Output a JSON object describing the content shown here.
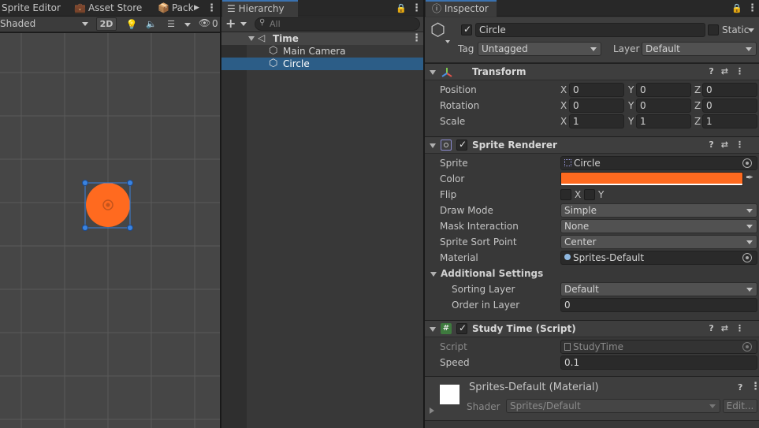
{
  "scene": {
    "tabs": [
      "Sprite Editor",
      "Asset Store",
      "Pack"
    ],
    "shading_mode": "Shaded",
    "mode_2d": "2D",
    "hidden_count": "0",
    "circle_color": "#ff6a1f"
  },
  "hierarchy": {
    "tab_label": "Hierarchy",
    "search_placeholder": "All",
    "scene_name": "Time",
    "items": [
      "Main Camera",
      "Circle"
    ],
    "selected": "Circle"
  },
  "inspector": {
    "tab_label": "Inspector",
    "object_name": "Circle",
    "static_label": "Static",
    "tag_label": "Tag",
    "tag_value": "Untagged",
    "layer_label": "Layer",
    "layer_value": "Default",
    "transform": {
      "title": "Transform",
      "position_label": "Position",
      "rotation_label": "Rotation",
      "scale_label": "Scale",
      "axis_x": "X",
      "axis_y": "Y",
      "axis_z": "Z",
      "position": [
        "0",
        "0",
        "0"
      ],
      "rotation": [
        "0",
        "0",
        "0"
      ],
      "scale": [
        "1",
        "1",
        "1"
      ]
    },
    "sprite_renderer": {
      "title": "Sprite Renderer",
      "sprite_label": "Sprite",
      "sprite_value": "Circle",
      "color_label": "Color",
      "color_value": "#ff6a1f",
      "flip_label": "Flip",
      "flip_x": "X",
      "flip_y": "Y",
      "draw_mode_label": "Draw Mode",
      "draw_mode_value": "Simple",
      "mask_label": "Mask Interaction",
      "mask_value": "None",
      "sort_point_label": "Sprite Sort Point",
      "sort_point_value": "Center",
      "material_label": "Material",
      "material_value": "Sprites-Default",
      "additional_label": "Additional Settings",
      "sorting_layer_label": "Sorting Layer",
      "sorting_layer_value": "Default",
      "order_label": "Order in Layer",
      "order_value": "0"
    },
    "study_time": {
      "title": "Study Time (Script)",
      "script_label": "Script",
      "script_value": "StudyTime",
      "speed_label": "Speed",
      "speed_value": "0.1"
    },
    "material": {
      "title": "Sprites-Default (Material)",
      "shader_label": "Shader",
      "shader_value": "Sprites/Default",
      "edit_label": "Edit..."
    }
  }
}
